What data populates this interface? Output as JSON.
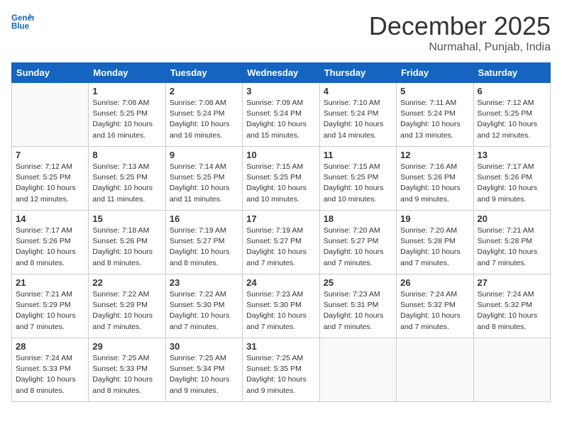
{
  "header": {
    "logo_line1": "General",
    "logo_line2": "Blue",
    "month": "December 2025",
    "location": "Nurmahal, Punjab, India"
  },
  "weekdays": [
    "Sunday",
    "Monday",
    "Tuesday",
    "Wednesday",
    "Thursday",
    "Friday",
    "Saturday"
  ],
  "weeks": [
    [
      {
        "day": "",
        "sunrise": "",
        "sunset": "",
        "daylight": ""
      },
      {
        "day": "1",
        "sunrise": "7:08 AM",
        "sunset": "5:25 PM",
        "daylight": "10 hours and 16 minutes."
      },
      {
        "day": "2",
        "sunrise": "7:08 AM",
        "sunset": "5:24 PM",
        "daylight": "10 hours and 16 minutes."
      },
      {
        "day": "3",
        "sunrise": "7:09 AM",
        "sunset": "5:24 PM",
        "daylight": "10 hours and 15 minutes."
      },
      {
        "day": "4",
        "sunrise": "7:10 AM",
        "sunset": "5:24 PM",
        "daylight": "10 hours and 14 minutes."
      },
      {
        "day": "5",
        "sunrise": "7:11 AM",
        "sunset": "5:24 PM",
        "daylight": "10 hours and 13 minutes."
      },
      {
        "day": "6",
        "sunrise": "7:12 AM",
        "sunset": "5:25 PM",
        "daylight": "10 hours and 12 minutes."
      }
    ],
    [
      {
        "day": "7",
        "sunrise": "7:12 AM",
        "sunset": "5:25 PM",
        "daylight": "10 hours and 12 minutes."
      },
      {
        "day": "8",
        "sunrise": "7:13 AM",
        "sunset": "5:25 PM",
        "daylight": "10 hours and 11 minutes."
      },
      {
        "day": "9",
        "sunrise": "7:14 AM",
        "sunset": "5:25 PM",
        "daylight": "10 hours and 11 minutes."
      },
      {
        "day": "10",
        "sunrise": "7:15 AM",
        "sunset": "5:25 PM",
        "daylight": "10 hours and 10 minutes."
      },
      {
        "day": "11",
        "sunrise": "7:15 AM",
        "sunset": "5:25 PM",
        "daylight": "10 hours and 10 minutes."
      },
      {
        "day": "12",
        "sunrise": "7:16 AM",
        "sunset": "5:26 PM",
        "daylight": "10 hours and 9 minutes."
      },
      {
        "day": "13",
        "sunrise": "7:17 AM",
        "sunset": "5:26 PM",
        "daylight": "10 hours and 9 minutes."
      }
    ],
    [
      {
        "day": "14",
        "sunrise": "7:17 AM",
        "sunset": "5:26 PM",
        "daylight": "10 hours and 8 minutes."
      },
      {
        "day": "15",
        "sunrise": "7:18 AM",
        "sunset": "5:26 PM",
        "daylight": "10 hours and 8 minutes."
      },
      {
        "day": "16",
        "sunrise": "7:19 AM",
        "sunset": "5:27 PM",
        "daylight": "10 hours and 8 minutes."
      },
      {
        "day": "17",
        "sunrise": "7:19 AM",
        "sunset": "5:27 PM",
        "daylight": "10 hours and 7 minutes."
      },
      {
        "day": "18",
        "sunrise": "7:20 AM",
        "sunset": "5:27 PM",
        "daylight": "10 hours and 7 minutes."
      },
      {
        "day": "19",
        "sunrise": "7:20 AM",
        "sunset": "5:28 PM",
        "daylight": "10 hours and 7 minutes."
      },
      {
        "day": "20",
        "sunrise": "7:21 AM",
        "sunset": "5:28 PM",
        "daylight": "10 hours and 7 minutes."
      }
    ],
    [
      {
        "day": "21",
        "sunrise": "7:21 AM",
        "sunset": "5:29 PM",
        "daylight": "10 hours and 7 minutes."
      },
      {
        "day": "22",
        "sunrise": "7:22 AM",
        "sunset": "5:29 PM",
        "daylight": "10 hours and 7 minutes."
      },
      {
        "day": "23",
        "sunrise": "7:22 AM",
        "sunset": "5:30 PM",
        "daylight": "10 hours and 7 minutes."
      },
      {
        "day": "24",
        "sunrise": "7:23 AM",
        "sunset": "5:30 PM",
        "daylight": "10 hours and 7 minutes."
      },
      {
        "day": "25",
        "sunrise": "7:23 AM",
        "sunset": "5:31 PM",
        "daylight": "10 hours and 7 minutes."
      },
      {
        "day": "26",
        "sunrise": "7:24 AM",
        "sunset": "5:32 PM",
        "daylight": "10 hours and 7 minutes."
      },
      {
        "day": "27",
        "sunrise": "7:24 AM",
        "sunset": "5:32 PM",
        "daylight": "10 hours and 8 minutes."
      }
    ],
    [
      {
        "day": "28",
        "sunrise": "7:24 AM",
        "sunset": "5:33 PM",
        "daylight": "10 hours and 8 minutes."
      },
      {
        "day": "29",
        "sunrise": "7:25 AM",
        "sunset": "5:33 PM",
        "daylight": "10 hours and 8 minutes."
      },
      {
        "day": "30",
        "sunrise": "7:25 AM",
        "sunset": "5:34 PM",
        "daylight": "10 hours and 9 minutes."
      },
      {
        "day": "31",
        "sunrise": "7:25 AM",
        "sunset": "5:35 PM",
        "daylight": "10 hours and 9 minutes."
      },
      {
        "day": "",
        "sunrise": "",
        "sunset": "",
        "daylight": ""
      },
      {
        "day": "",
        "sunrise": "",
        "sunset": "",
        "daylight": ""
      },
      {
        "day": "",
        "sunrise": "",
        "sunset": "",
        "daylight": ""
      }
    ]
  ]
}
